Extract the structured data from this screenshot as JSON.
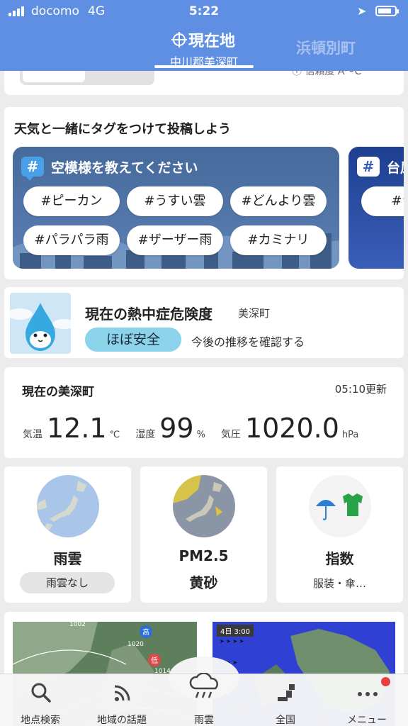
{
  "status_bar": {
    "carrier": "docomo",
    "network": "4G",
    "time": "5:22",
    "battery_level": 0.8
  },
  "header": {
    "current_tab_title": "現在地",
    "current_tab_subtitle": "中川郡美深町",
    "other_tab": "浜頓別町"
  },
  "top_card": {
    "reliability_text": "信頼度 A～C"
  },
  "tags": {
    "heading": "天気と一緒にタグをつけて投稿しよう",
    "panel1": {
      "title": "空模様を教えてください",
      "chips": [
        "#ピーカン",
        "#うすい雲",
        "#どんより雲",
        "#パラパラ雨",
        "#ザーザー雨",
        "#カミナリ"
      ]
    },
    "panel2": {
      "title": "台風",
      "chip": "#台風"
    }
  },
  "heat": {
    "title": "現在の熱中症危険度",
    "place": "美深町",
    "level": "ほぼ安全",
    "link": "今後の推移を確認する"
  },
  "observation": {
    "title": "現在の美深町",
    "updated": "05:10更新",
    "temp_label": "気温",
    "temp_value": "12.1",
    "temp_unit": "℃",
    "humidity_label": "湿度",
    "humidity_value": "99",
    "humidity_unit": "%",
    "pressure_label": "気圧",
    "pressure_value": "1020.0",
    "pressure_unit": "hPa"
  },
  "tiles": {
    "rain_label": "雨雲",
    "rain_status": "雨雲なし",
    "pm_label_1": "PM2.5",
    "pm_label_2": "黄砂",
    "index_label": "指数",
    "index_sub": "服装・傘…"
  },
  "maps": {
    "map_b_stamp": "4日 3:00",
    "isobar_1": "1002",
    "isobar_2": "1020",
    "isobar_3": "1014",
    "high": "高",
    "low": "低"
  },
  "nav": {
    "search": "地点検索",
    "topics": "地域の話題",
    "rain": "雨雲",
    "national": "全国",
    "menu": "メニュー"
  },
  "colors": {
    "header_blue": "#5f8fe3",
    "safe_pill": "#8bd3ea",
    "badge_red": "#e9403f"
  }
}
